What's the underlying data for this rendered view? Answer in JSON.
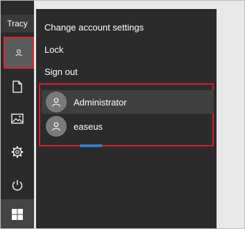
{
  "user": {
    "name": "Tracy"
  },
  "menu": {
    "change_settings": "Change account settings",
    "lock": "Lock",
    "sign_out": "Sign out"
  },
  "accounts": [
    {
      "name": "Administrator",
      "icon": "person-icon"
    },
    {
      "name": "easeus",
      "icon": "person-icon"
    }
  ],
  "rail_icons": [
    "person-icon",
    "document-icon",
    "pictures-icon",
    "gear-icon",
    "power-icon",
    "windows-logo-icon"
  ],
  "colors": {
    "highlight_border": "#e0242b",
    "accent": "#2f7fd0",
    "flyout_bg": "#2b2b2b"
  }
}
